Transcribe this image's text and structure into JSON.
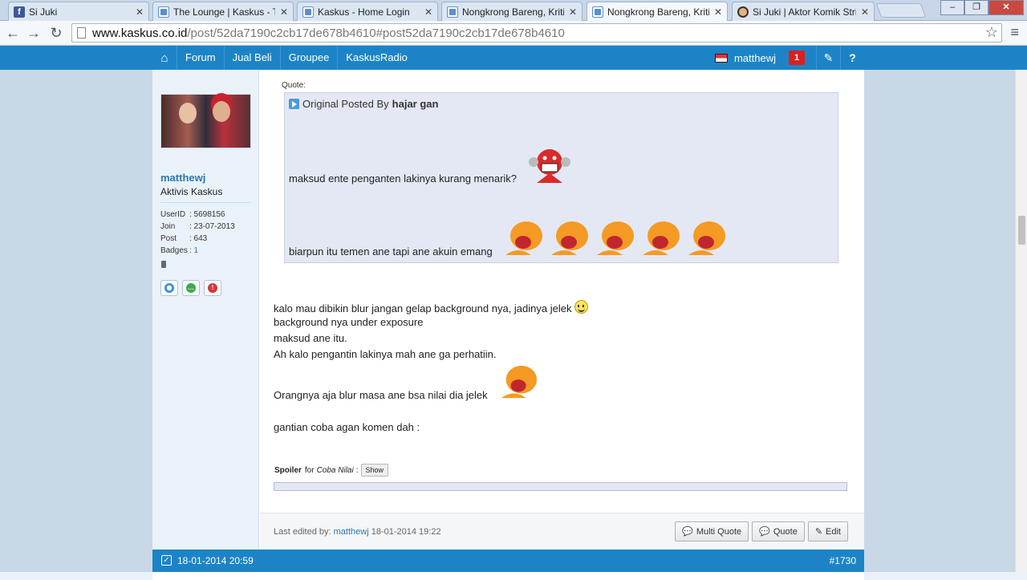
{
  "tabs": [
    {
      "label": "Si Juki",
      "icon": "facebook-icon"
    },
    {
      "label": "The Lounge | Kaskus - The",
      "icon": "kaskus-icon"
    },
    {
      "label": "Kaskus - Home Login",
      "icon": "kaskus-icon"
    },
    {
      "label": "Nongkrong Bareng, Kritik",
      "icon": "kaskus-icon"
    },
    {
      "label": "Nongkrong Bareng, Kritik",
      "icon": "kaskus-icon",
      "active": true
    },
    {
      "label": "Si Juki | Aktor Komik Strip",
      "icon": "face-icon"
    }
  ],
  "address": {
    "host": "www.kaskus.co.id",
    "path": "/post/52da7190c2cb17de678b4610#post52da7190c2cb17de678b4610"
  },
  "sitenav": {
    "links": [
      "Forum",
      "Jual Beli",
      "Groupee",
      "KaskusRadio"
    ],
    "username": "matthewj",
    "notifications": "1"
  },
  "user": {
    "name": "matthewj",
    "rank": "Aktivis Kaskus",
    "stats": [
      {
        "key": "UserID",
        "value": ": 5698156"
      },
      {
        "key": "Join",
        "value": ": 23-07-2013"
      },
      {
        "key": "Post",
        "value": ": 643"
      },
      {
        "key": "Badges",
        "value": ": 1"
      }
    ]
  },
  "quote": {
    "label": "Quote:",
    "posted_by_prefix": "Original Posted By",
    "author": "hajar gan",
    "line1": "maksud ente penganten lakinya kurang menarik?",
    "line2": "biarpun itu temen ane tapi ane akuin emang"
  },
  "body": {
    "line1": "kalo mau dibikin blur jangan gelap background nya, jadinya jelek",
    "line2": "background nya under exposure",
    "line3": "maksud ane itu.",
    "line4": "Ah kalo pengantin lakinya mah ane ga perhatiin.",
    "line5": "Orangnya aja blur masa ane bsa nilai dia jelek",
    "line6": "gantian coba agan komen dah :"
  },
  "spoiler": {
    "label": "Spoiler",
    "for": "for",
    "title": "Coba Nilai",
    "button": "Show"
  },
  "footer": {
    "last_edited_prefix": "Last edited by:",
    "last_edited_user": "matthewj",
    "last_edited_date": "18-01-2014 19:22",
    "buttons": {
      "multi_quote": "Multi Quote",
      "quote": "Quote",
      "edit": "Edit"
    }
  },
  "next_post": {
    "date": "18-01-2014 20:59",
    "number": "#1730"
  },
  "colors": {
    "brand_blue": "#1c84c6",
    "link_blue": "#2b77b0",
    "quote_bg": "#e4e8f5"
  }
}
